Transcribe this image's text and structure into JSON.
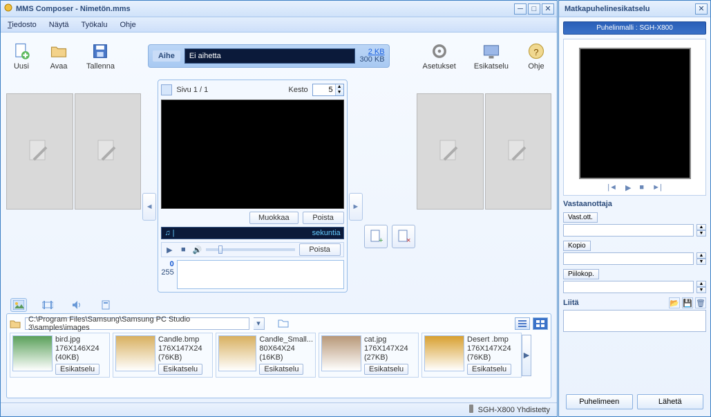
{
  "left": {
    "title": "MMS Composer - Nimetön.mms",
    "menu": {
      "file": "Tiedosto",
      "view": "Näytä",
      "tools": "Työkalu",
      "help": "Ohje"
    },
    "toolbar": {
      "new": "Uusi",
      "open": "Avaa",
      "save": "Tallenna",
      "settings": "Asetukset",
      "preview": "Esikatselu",
      "help": "Ohje"
    },
    "subject": {
      "label": "Aihe",
      "value": "Ei aihetta",
      "used": "2 KB",
      "total": "300 KB"
    },
    "page": {
      "indicator": "Sivu 1 / 1",
      "duration_label": "Kesto",
      "duration_value": "5"
    },
    "buttons": {
      "edit": "Muokkaa",
      "delete": "Poista"
    },
    "audio": {
      "right": "sekuntia"
    },
    "counter": {
      "cur": "0",
      "max": "255"
    },
    "path": "C:\\Program Files\\Samsung\\Samsung PC Studio 3\\samples\\images",
    "preview_btn": "Esikatselu",
    "files": [
      {
        "name": "bird.jpg",
        "dim": "176X146X24",
        "size": "(40KB)"
      },
      {
        "name": "Candle.bmp",
        "dim": "176X147X24",
        "size": "(76KB)"
      },
      {
        "name": "Candle_Small...",
        "dim": "80X64X24",
        "size": "(16KB)"
      },
      {
        "name": "cat.jpg",
        "dim": "176X147X24",
        "size": "(27KB)"
      },
      {
        "name": "Desert .bmp",
        "dim": "176X147X24",
        "size": "(76KB)"
      }
    ],
    "status": "SGH-X800 Yhdistetty"
  },
  "right": {
    "title": "Matkapuhelinesikatselu",
    "model": "Puhelinmalli : SGH-X800",
    "recipients_label": "Vastaanottaja",
    "to": "Vast.ott.",
    "cc": "Kopio",
    "bcc": "Piilokop.",
    "attach": "Liitä",
    "to_phone": "Puhelimeen",
    "send": "Lähetä"
  }
}
